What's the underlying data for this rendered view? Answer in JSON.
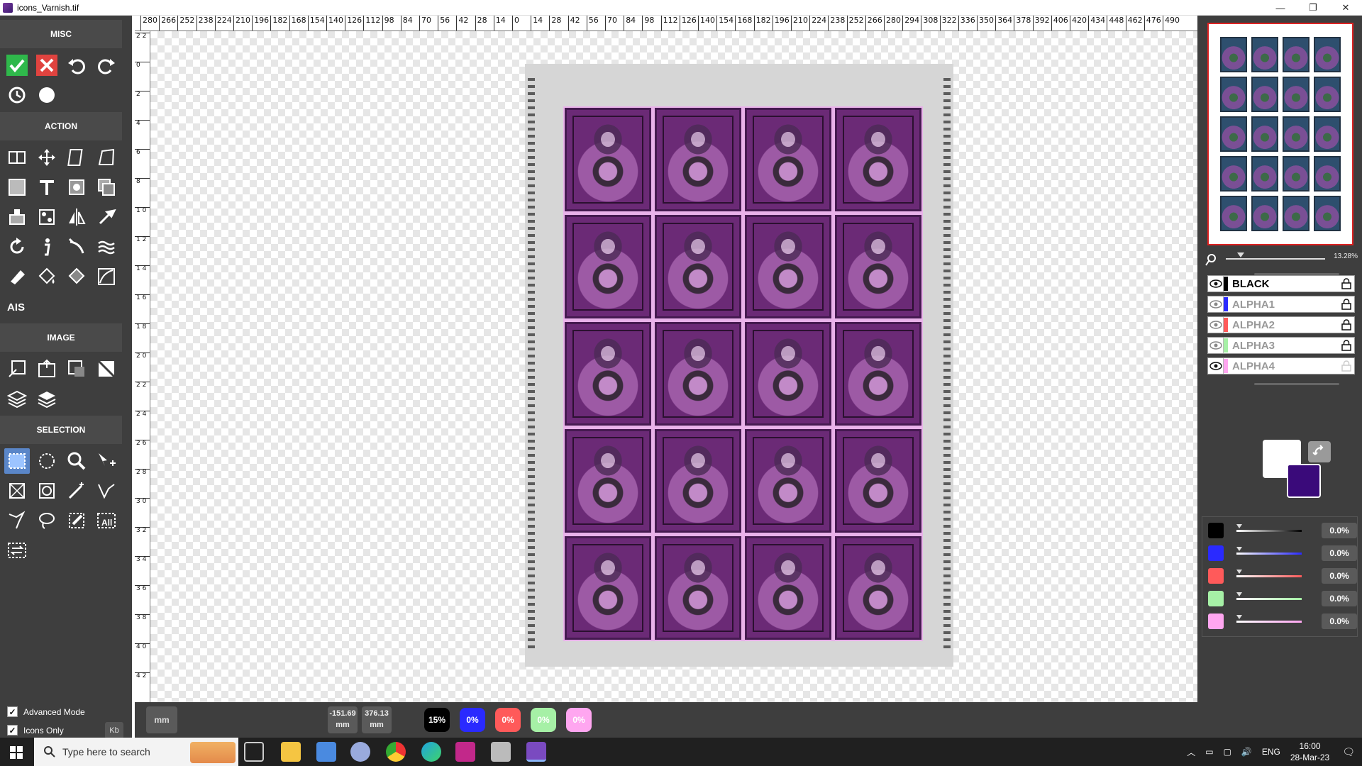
{
  "window": {
    "title": "icons_Varnish.tif",
    "controls": [
      "—",
      "❐",
      "✕"
    ]
  },
  "toolpanel": {
    "sections": {
      "misc": "MISC",
      "action": "ACTION",
      "image": "IMAGE",
      "selection": "SELECTION"
    },
    "ais_label": "AIS",
    "select_all_label": "All",
    "options": {
      "advanced_mode": "Advanced Mode",
      "icons_only": "Icons Only",
      "kb": "Kb"
    }
  },
  "rulers": {
    "h_labels": [
      "280",
      "266",
      "252",
      "238",
      "224",
      "210",
      "196",
      "182",
      "168",
      "154",
      "140",
      "126",
      "112",
      "98",
      "84",
      "70",
      "56",
      "42",
      "28",
      "14",
      "0",
      "14",
      "28",
      "42",
      "56",
      "70",
      "84",
      "98",
      "112",
      "126",
      "140",
      "154",
      "168",
      "182",
      "196",
      "210",
      "224",
      "238",
      "252",
      "266",
      "280",
      "294",
      "308",
      "322",
      "336",
      "350",
      "364",
      "378",
      "392",
      "406",
      "420",
      "434",
      "448",
      "462",
      "476",
      "490"
    ],
    "v_labels": [
      "2 2",
      "0",
      "2",
      "4",
      "6",
      "8",
      "1 0",
      "1 2",
      "1 4",
      "1 6",
      "1 8",
      "2 0",
      "2 2",
      "2 4",
      "2 6",
      "2 8",
      "3 0",
      "3 2",
      "3 4",
      "3 6",
      "3 8",
      "4 0",
      "4 2"
    ]
  },
  "statusbar": {
    "unit": "mm",
    "x": {
      "value": "-151.69",
      "unit": "mm"
    },
    "y": {
      "value": "376.13",
      "unit": "mm"
    },
    "inks": [
      {
        "label": "15%",
        "color": "#000000"
      },
      {
        "label": "0%",
        "color": "#2a2aff"
      },
      {
        "label": "0%",
        "color": "#ff5a5a"
      },
      {
        "label": "0%",
        "color": "#a6f0a6"
      },
      {
        "label": "0%",
        "color": "#ffa6f0"
      }
    ]
  },
  "rightpanel": {
    "zoom": "13.28%",
    "layers": [
      {
        "name": "BLACK",
        "color": "#000000",
        "active": true
      },
      {
        "name": "ALPHA1",
        "color": "#2a2aff",
        "active": false
      },
      {
        "name": "ALPHA2",
        "color": "#ff5a5a",
        "active": false
      },
      {
        "name": "ALPHA3",
        "color": "#a6f0a6",
        "active": false
      },
      {
        "name": "ALPHA4",
        "color": "#ffa6f0",
        "active": false
      }
    ],
    "foreground": "#ffffff",
    "background": "#3a0a7a",
    "ink_levels": [
      {
        "color": "#000000",
        "value": "0.0%"
      },
      {
        "color": "#2a2aff",
        "value": "0.0%"
      },
      {
        "color": "#ff5a5a",
        "value": "0.0%"
      },
      {
        "color": "#a6f0a6",
        "value": "0.0%"
      },
      {
        "color": "#ffa6f0",
        "value": "0.0%"
      }
    ]
  },
  "taskbar": {
    "search_placeholder": "Type here to search",
    "language": "ENG",
    "time": "16:00",
    "date": "28-Mar-23"
  }
}
